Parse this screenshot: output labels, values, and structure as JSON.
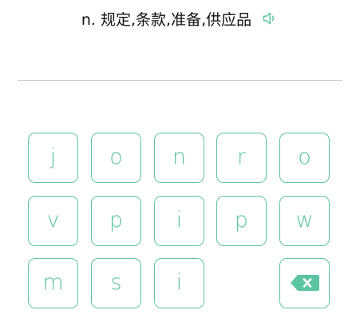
{
  "prompt": {
    "definition": "n. 规定,条款,准备,供应品"
  },
  "colors": {
    "accent": "#5cc4a3",
    "text": "#111111",
    "divider": "#c8c8c8"
  },
  "icons": {
    "speaker": "speaker-icon",
    "backspace": "backspace-icon"
  },
  "keyboard": {
    "rows": [
      [
        "j",
        "o",
        "n",
        "r",
        "o"
      ],
      [
        "v",
        "p",
        "i",
        "p",
        "w"
      ],
      [
        "m",
        "s",
        "i"
      ]
    ]
  }
}
